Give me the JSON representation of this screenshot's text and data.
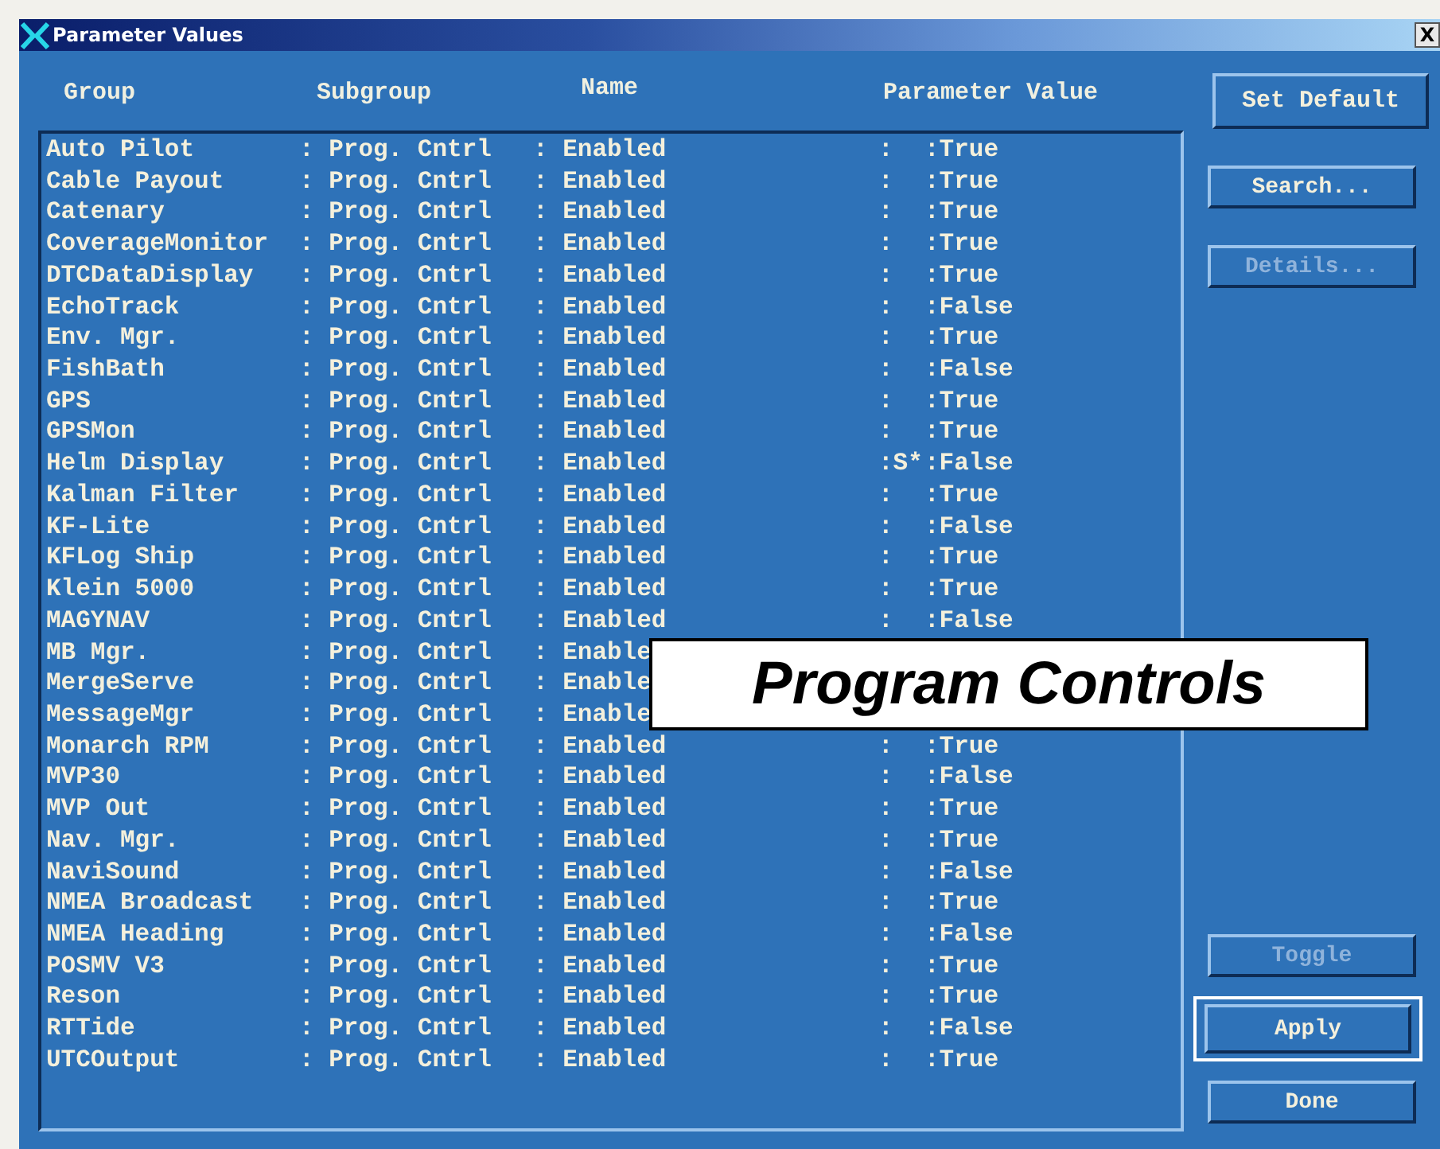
{
  "window": {
    "title": "Parameter Values",
    "close": "X"
  },
  "columns": [
    "Group",
    "Subgroup",
    "Name",
    "Parameter Value"
  ],
  "rows": [
    {
      "group": "Auto Pilot",
      "subgroup": ": Prog. Cntrl",
      "name": ": Enabled",
      "flag": ":",
      "value": ":True"
    },
    {
      "group": "Cable Payout",
      "subgroup": ": Prog. Cntrl",
      "name": ": Enabled",
      "flag": ":",
      "value": ":True"
    },
    {
      "group": "Catenary",
      "subgroup": ": Prog. Cntrl",
      "name": ": Enabled",
      "flag": ":",
      "value": ":True"
    },
    {
      "group": "CoverageMonitor",
      "subgroup": ": Prog. Cntrl",
      "name": ": Enabled",
      "flag": ":",
      "value": ":True"
    },
    {
      "group": "DTCDataDisplay",
      "subgroup": ": Prog. Cntrl",
      "name": ": Enabled",
      "flag": ":",
      "value": ":True"
    },
    {
      "group": "EchoTrack",
      "subgroup": ": Prog. Cntrl",
      "name": ": Enabled",
      "flag": ":",
      "value": ":False"
    },
    {
      "group": "Env. Mgr.",
      "subgroup": ": Prog. Cntrl",
      "name": ": Enabled",
      "flag": ":",
      "value": ":True"
    },
    {
      "group": "FishBath",
      "subgroup": ": Prog. Cntrl",
      "name": ": Enabled",
      "flag": ":",
      "value": ":False"
    },
    {
      "group": "GPS",
      "subgroup": ": Prog. Cntrl",
      "name": ": Enabled",
      "flag": ":",
      "value": ":True"
    },
    {
      "group": "GPSMon",
      "subgroup": ": Prog. Cntrl",
      "name": ": Enabled",
      "flag": ":",
      "value": ":True"
    },
    {
      "group": "Helm Display",
      "subgroup": ": Prog. Cntrl",
      "name": ": Enabled",
      "flag": ":S*",
      "value": ":False"
    },
    {
      "group": "Kalman Filter",
      "subgroup": ": Prog. Cntrl",
      "name": ": Enabled",
      "flag": ":",
      "value": ":True"
    },
    {
      "group": "KF-Lite",
      "subgroup": ": Prog. Cntrl",
      "name": ": Enabled",
      "flag": ":",
      "value": ":False"
    },
    {
      "group": "KFLog Ship",
      "subgroup": ": Prog. Cntrl",
      "name": ": Enabled",
      "flag": ":",
      "value": ":True"
    },
    {
      "group": "Klein 5000",
      "subgroup": ": Prog. Cntrl",
      "name": ": Enabled",
      "flag": ":",
      "value": ":True"
    },
    {
      "group": "MAGYNAV",
      "subgroup": ": Prog. Cntrl",
      "name": ": Enabled",
      "flag": ":",
      "value": ":False"
    },
    {
      "group": "MB Mgr.",
      "subgroup": ": Prog. Cntrl",
      "name": ": Enable"
    },
    {
      "group": "MergeServe",
      "subgroup": ": Prog. Cntrl",
      "name": ": Enable"
    },
    {
      "group": "MessageMgr",
      "subgroup": ": Prog. Cntrl",
      "name": ": Enable"
    },
    {
      "group": "Monarch RPM",
      "subgroup": ": Prog. Cntrl",
      "name": ": Enabled",
      "flag": ":",
      "value": ":True"
    },
    {
      "group": "MVP30",
      "subgroup": ": Prog. Cntrl",
      "name": ": Enabled",
      "flag": ":",
      "value": ":False"
    },
    {
      "group": "MVP Out",
      "subgroup": ": Prog. Cntrl",
      "name": ": Enabled",
      "flag": ":",
      "value": ":True"
    },
    {
      "group": "Nav. Mgr.",
      "subgroup": ": Prog. Cntrl",
      "name": ": Enabled",
      "flag": ":",
      "value": ":True"
    },
    {
      "group": "NaviSound",
      "subgroup": ": Prog. Cntrl",
      "name": ": Enabled",
      "flag": ":",
      "value": ":False"
    },
    {
      "group": "NMEA Broadcast",
      "subgroup": ": Prog. Cntrl",
      "name": ": Enabled",
      "flag": ":",
      "value": ":True"
    },
    {
      "group": "NMEA Heading",
      "subgroup": ": Prog. Cntrl",
      "name": ": Enabled",
      "flag": ":",
      "value": ":False"
    },
    {
      "group": "POSMV V3",
      "subgroup": ": Prog. Cntrl",
      "name": ": Enabled",
      "flag": ":",
      "value": ":True"
    },
    {
      "group": "Reson",
      "subgroup": ": Prog. Cntrl",
      "name": ": Enabled",
      "flag": ":",
      "value": ":True"
    },
    {
      "group": "RTTide",
      "subgroup": ": Prog. Cntrl",
      "name": ": Enabled",
      "flag": ":",
      "value": ":False"
    },
    {
      "group": "UTCOutput",
      "subgroup": ": Prog. Cntrl",
      "name": ": Enabled",
      "flag": ":",
      "value": ":True"
    }
  ],
  "buttons": [
    {
      "label": "Set Default",
      "kind": "top",
      "disabled": false,
      "default": false
    },
    {
      "label": "Search...",
      "kind": "top",
      "disabled": false,
      "default": false
    },
    {
      "label": "Details...",
      "kind": "top",
      "disabled": true,
      "default": false
    },
    {
      "label": "Toggle",
      "kind": "bottom",
      "disabled": true,
      "default": false
    },
    {
      "label": "Apply",
      "kind": "bottom",
      "disabled": false,
      "default": true
    },
    {
      "label": "Done",
      "kind": "bottom",
      "disabled": false,
      "default": false
    }
  ],
  "overlay_label": "Program Controls"
}
